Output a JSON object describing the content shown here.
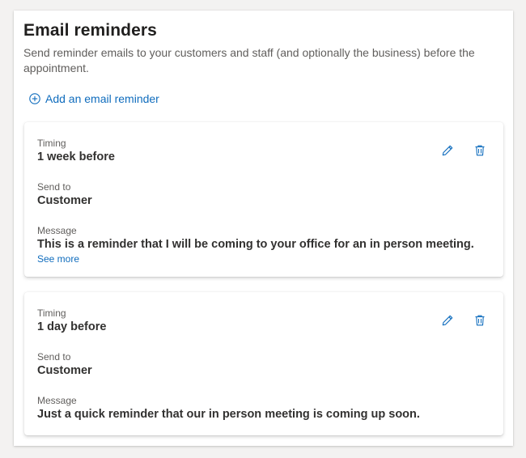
{
  "section": {
    "title": "Email reminders",
    "description": "Send reminder emails to your customers and staff (and optionally the business) before the appointment.",
    "add_label": "Add an email reminder"
  },
  "colors": {
    "accent": "#0f6cbd",
    "text": "#323130",
    "muted": "#605e5c"
  },
  "icons": {
    "add": "add-circle-icon",
    "edit": "pencil-icon",
    "delete": "trash-icon"
  },
  "reminders": [
    {
      "timing_label": "Timing",
      "timing": "1 week before",
      "sendto_label": "Send to",
      "sendto": "Customer",
      "message_label": "Message",
      "message": "This is a reminder that I will be coming to your office for an in person meeting.",
      "see_more": "See more"
    },
    {
      "timing_label": "Timing",
      "timing": "1 day before",
      "sendto_label": "Send to",
      "sendto": "Customer",
      "message_label": "Message",
      "message": "Just a quick reminder that our in person meeting is coming up soon."
    }
  ]
}
